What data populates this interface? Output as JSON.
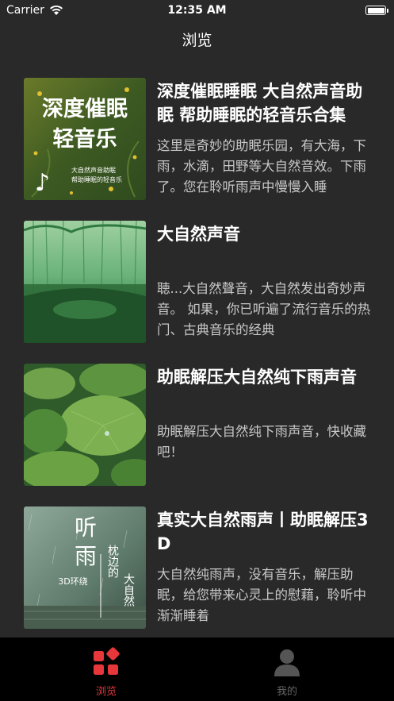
{
  "status_bar": {
    "carrier": "Carrier",
    "time": "12:35 AM"
  },
  "nav": {
    "title": "浏览"
  },
  "items": [
    {
      "title": "深度催眠睡眠 大自然声音助眠 帮助睡眠的轻音乐合集",
      "description": "这里是奇妙的助眠乐园，有大海，下雨，水滴，田野等大自然音效。下雨了。您在聆听雨声中慢慢入睡",
      "cover_title_line1": "深度催眠",
      "cover_title_line2": "轻音乐",
      "cover_subtitle_line1": "大自然声音助眠",
      "cover_subtitle_line2": "帮助睡眠的轻音乐"
    },
    {
      "title": "大自然声音",
      "description": "聴...大自然聲音，大自然发出奇妙声音。 如果，你已听遍了流行音乐的热门、古典音乐的经典"
    },
    {
      "title": "助眠解压大自然纯下雨声音",
      "description": "助眠解压大自然纯下雨声音，快收藏吧！"
    },
    {
      "title": "真实大自然雨声丨助眠解压3D",
      "description": "大自然纯雨声，没有音乐，解压助眠，给您带来心灵上的慰藉，聆听中渐渐睡着",
      "cover_big_line1": "听",
      "cover_big_line2": "雨",
      "cover_small": "3D环绕",
      "cover_vertical1": "枕边的",
      "cover_vertical2": "大自然"
    }
  ],
  "tab_bar": {
    "browse_label": "浏览",
    "mine_label": "我的",
    "active_color": "#e8373b",
    "inactive_color": "#666666"
  },
  "colors": {
    "background": "#292929",
    "tab_background": "#000000"
  }
}
